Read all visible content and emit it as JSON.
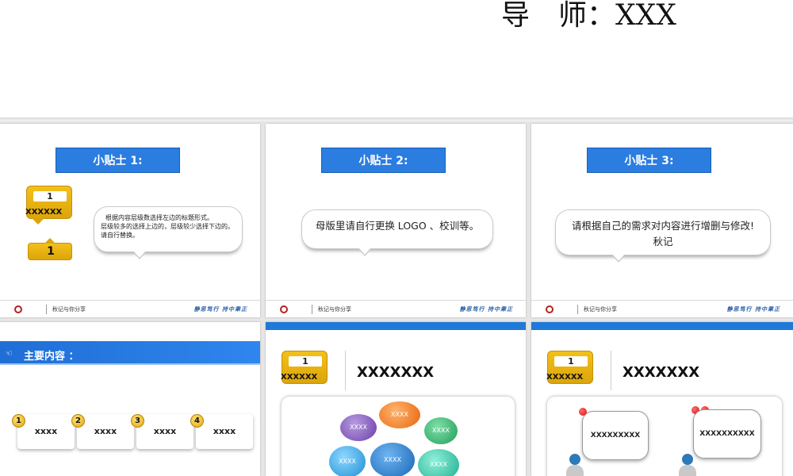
{
  "header": {
    "title_left": "导",
    "title_right": "师：XXX"
  },
  "tips": [
    {
      "title": "小贴士 1:",
      "badge_num": "1",
      "badge_label": "XXXXXX",
      "small_badge_num": "1",
      "lines": [
        "根据内容层级数选择左边的标题形式。",
        "层级较多的选择上边的，层级较少选择下边的。",
        "请自行替换。"
      ]
    },
    {
      "title": "小贴士 2:",
      "lines": [
        "母版里请自行更换 LOGO 、校训等。"
      ]
    },
    {
      "title": "小贴士 3:",
      "lines": [
        "请根据自己的需求对内容进行增删与修改!",
        "秋记"
      ]
    }
  ],
  "footer": {
    "share": "秋记与你分享",
    "motto": "静思笃行 持中秉正"
  },
  "main_content": {
    "title": "主要内容 ：",
    "items": [
      {
        "num": "1",
        "label": "xxxx"
      },
      {
        "num": "2",
        "label": "xxxx"
      },
      {
        "num": "3",
        "label": "xxxx"
      },
      {
        "num": "4",
        "label": "xxxx"
      }
    ]
  },
  "slide5": {
    "badge_num": "1",
    "badge_label": "XXXXXX",
    "heading": "XXXXXXX",
    "bubbles": [
      "XXXX",
      "XXXX",
      "XXXX",
      "XXXX",
      "XXXX",
      "XXXX"
    ]
  },
  "slide6": {
    "badge_num": "1",
    "badge_label": "XXXXXX",
    "heading": "XXXXXXX",
    "speech": [
      "XXXXXXXXX",
      "XXXXXXXXXX"
    ]
  }
}
